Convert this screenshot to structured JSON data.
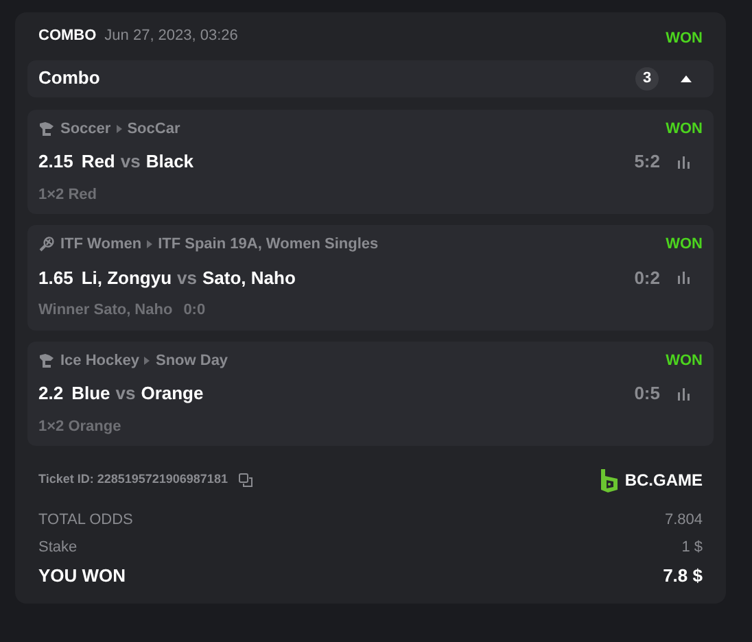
{
  "header": {
    "type": "COMBO",
    "date": "Jun 27, 2023, 03:26",
    "status": "WON"
  },
  "combo": {
    "title": "Combo",
    "count": "3",
    "expanded": true
  },
  "bets": [
    {
      "kind": "soccer",
      "sport": "Soccer",
      "league": "SocCar",
      "status": "WON",
      "odds": "2.15",
      "home": "Red",
      "vs": "vs",
      "away": "Black",
      "score": "5:2",
      "selection": "1×2 Red"
    },
    {
      "kind": "tennis",
      "sport": "ITF Women",
      "league": "ITF Spain 19A, Women Singles",
      "status": "WON",
      "odds": "1.65",
      "home": "Li, Zongyu",
      "vs": "vs",
      "away": "Sato, Naho",
      "score": "0:2",
      "selection": "Winner Sato, Naho",
      "selection_score": "0:0"
    },
    {
      "kind": "hockey",
      "sport": "Ice Hockey",
      "league": "Snow Day",
      "status": "WON",
      "odds": "2.2",
      "home": "Blue",
      "vs": "vs",
      "away": "Orange",
      "score": "0:5",
      "selection": "1×2 Orange"
    }
  ],
  "ticket": {
    "id": "Ticket ID: 2285195721906987181",
    "brand": "BC.GAME"
  },
  "summary": [
    {
      "kind": "muted",
      "label": "TOTAL ODDS",
      "value": "7.804"
    },
    {
      "kind": "muted",
      "label": "Stake",
      "value": "1 $"
    },
    {
      "kind": "strong",
      "label": "YOU WON",
      "value": "7.8 $"
    }
  ]
}
